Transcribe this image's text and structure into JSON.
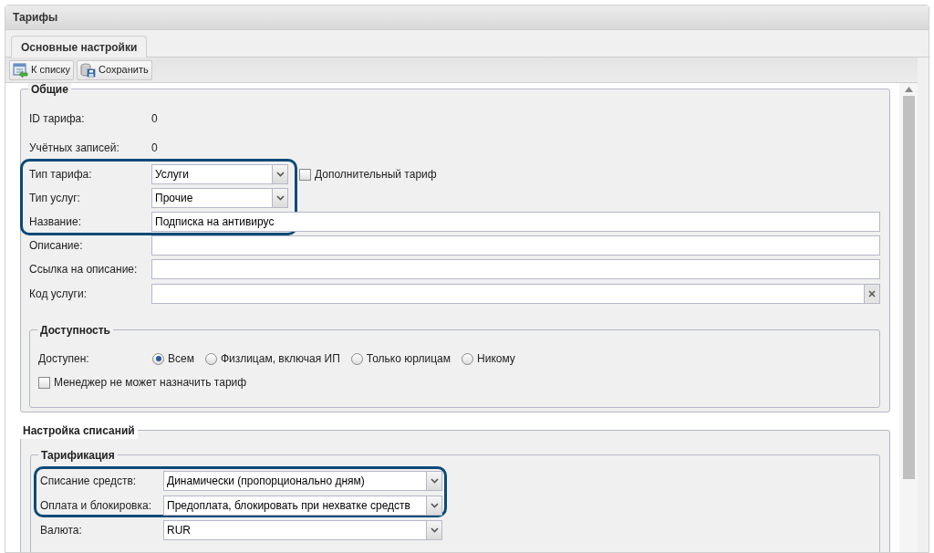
{
  "window": {
    "title": "Тарифы"
  },
  "tabs": [
    {
      "label": "Основные настройки",
      "selected": true
    }
  ],
  "toolbar": [
    {
      "label": "К списку",
      "kind": "back"
    },
    {
      "label": "Сохранить",
      "kind": "save"
    }
  ],
  "general": {
    "legend": "Общие",
    "rows": [
      {
        "label": "ID тарифа:",
        "kind": "text",
        "value": "0",
        "highlighted": false
      },
      {
        "label": "Учётных записей:",
        "kind": "text",
        "value": "0",
        "highlighted": false
      },
      {
        "label": "Тип тарифа:",
        "kind": "combo",
        "value": "Услуги",
        "highlighted": true,
        "checkbox": {
          "label": "Дополнительный тариф",
          "checked": false
        }
      },
      {
        "label": "Тип услуг:",
        "kind": "combo",
        "value": "Прочие",
        "highlighted": true
      },
      {
        "label": "Название:",
        "kind": "input",
        "value": "Подписка на антивирус",
        "highlighted": true
      },
      {
        "label": "Описание:",
        "kind": "input",
        "highlighted": false
      },
      {
        "label": "Ссылка на описание:",
        "kind": "input",
        "highlighted": false
      },
      {
        "label": "Код услуги:",
        "kind": "clearable",
        "highlighted": false
      }
    ]
  },
  "availability": {
    "legend": "Доступность",
    "label": "Доступен:",
    "options": [
      {
        "label": "Всем",
        "selected": true
      },
      {
        "label": "Физлицам, включая ИП",
        "selected": false
      },
      {
        "label": "Только юрлицам",
        "selected": false
      },
      {
        "label": "Никому",
        "selected": false
      }
    ],
    "manager_lock": {
      "label": "Менеджер не может назначить тариф",
      "checked": false
    }
  },
  "charging": {
    "legend": "Настройка списаний",
    "sub_legend": "Тарификация",
    "rows": [
      {
        "label": "Списание средств:",
        "value": "Динамически (пропорционально дням)",
        "highlighted": true
      },
      {
        "label": "Оплата и блокировка:",
        "value": "Предоплата, блокировать при нехватке средств",
        "highlighted": true
      },
      {
        "label": "Валюта:",
        "value": "RUR",
        "highlighted": false
      }
    ]
  }
}
